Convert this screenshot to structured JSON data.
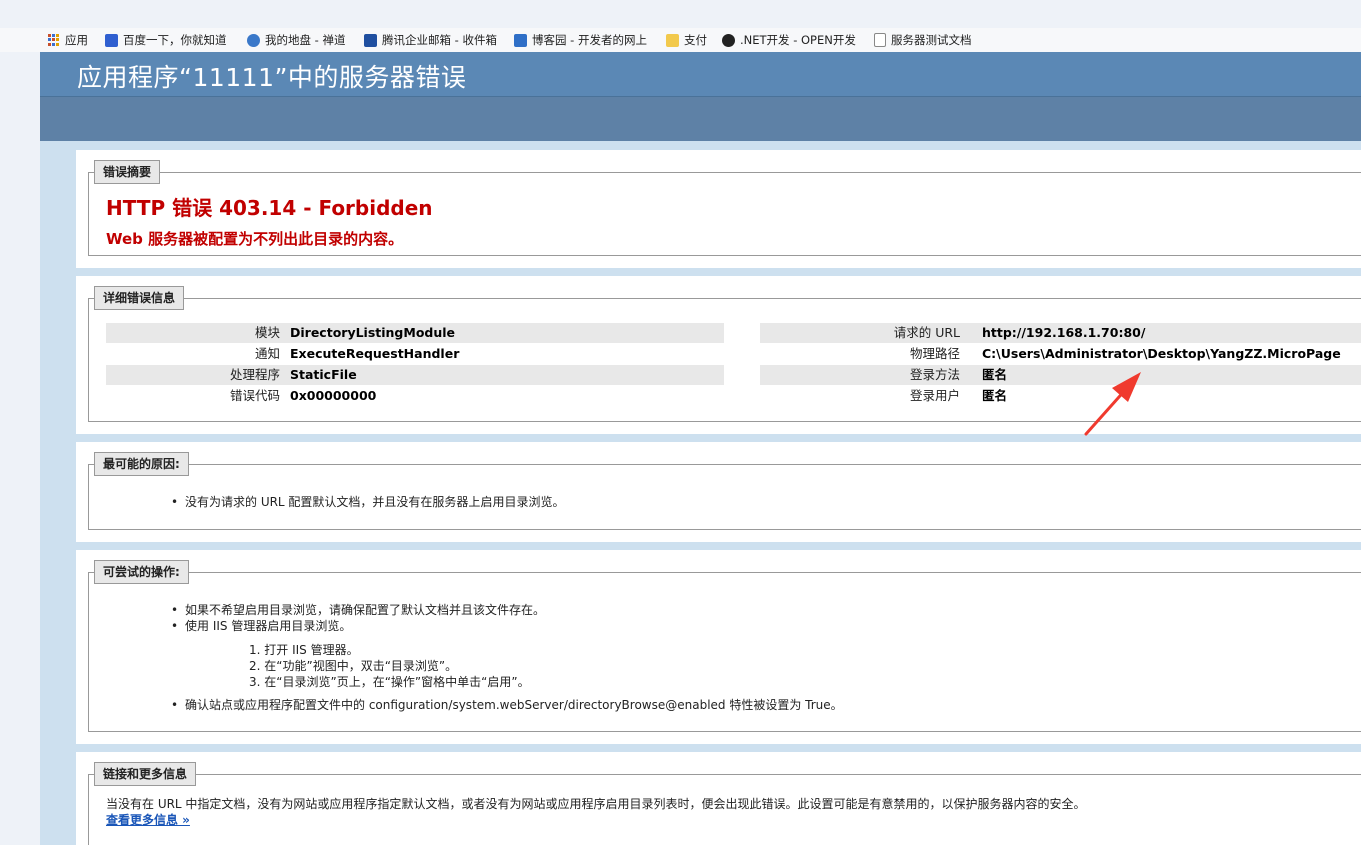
{
  "bookmarks": [
    {
      "label": "应用",
      "icon": "apps-grid-icon",
      "color": "#c94f2a"
    },
    {
      "label": "百度一下，你就知道",
      "icon": "baidu-icon",
      "color": "#2f5fd0"
    },
    {
      "label": "我的地盘 - 禅道",
      "icon": "zentao-icon",
      "color": "#3a78c9"
    },
    {
      "label": "腾讯企业邮箱 - 收件箱",
      "icon": "tencent-mail-icon",
      "color": "#1f4fa0"
    },
    {
      "label": "博客园 - 开发者的网上",
      "icon": "cnblogs-icon",
      "color": "#2f6fc7"
    },
    {
      "label": "支付",
      "icon": "folder-icon",
      "color": "#f2c94c"
    },
    {
      "label": ".NET开发 - OPEN开发",
      "icon": "github-icon",
      "color": "#222222"
    },
    {
      "label": "服务器测试文档",
      "icon": "document-icon",
      "color": "#888888"
    }
  ],
  "page": {
    "title": "应用程序“11111”中的服务器错误"
  },
  "summary": {
    "legend": "错误摘要",
    "title": "HTTP 错误 403.14 - Forbidden",
    "description": "Web 服务器被配置为不列出此目录的内容。"
  },
  "details": {
    "legend": "详细错误信息",
    "left": [
      {
        "label": "模块",
        "value": "DirectoryListingModule"
      },
      {
        "label": "通知",
        "value": "ExecuteRequestHandler"
      },
      {
        "label": "处理程序",
        "value": "StaticFile"
      },
      {
        "label": "错误代码",
        "value": "0x00000000"
      }
    ],
    "right": [
      {
        "label": "请求的 URL",
        "value": "http://192.168.1.70:80/"
      },
      {
        "label": "物理路径",
        "value": "C:\\Users\\Administrator\\Desktop\\YangZZ.MicroPage"
      },
      {
        "label": "登录方法",
        "value": "匿名"
      },
      {
        "label": "登录用户",
        "value": "匿名"
      }
    ]
  },
  "causes": {
    "legend": "最可能的原因:",
    "items": [
      "没有为请求的 URL 配置默认文档，并且没有在服务器上启用目录浏览。"
    ]
  },
  "actions": {
    "legend": "可尝试的操作:",
    "items": [
      "如果不希望启用目录浏览，请确保配置了默认文档并且该文件存在。",
      "使用 IIS 管理器启用目录浏览。"
    ],
    "steps": [
      "1. 打开 IIS 管理器。",
      "2. 在“功能”视图中，双击“目录浏览”。",
      "3. 在“目录浏览”页上，在“操作”窗格中单击“启用”。"
    ],
    "last_item": "确认站点或应用程序配置文件中的 configuration/system.webServer/directoryBrowse@enabled 特性被设置为 True。"
  },
  "links": {
    "legend": "链接和更多信息",
    "text": "当没有在 URL 中指定文档，没有为网站或应用程序指定默认文档，或者没有为网站或应用程序启用目录列表时，便会出现此错误。此设置可能是有意禁用的，以保护服务器内容的安全。",
    "more_link": "查看更多信息 »"
  },
  "colors": {
    "header": "#5b88b5",
    "error_red": "#c10000",
    "page_bg": "#cde0ef",
    "annotation_arrow": "#f03a2e"
  }
}
